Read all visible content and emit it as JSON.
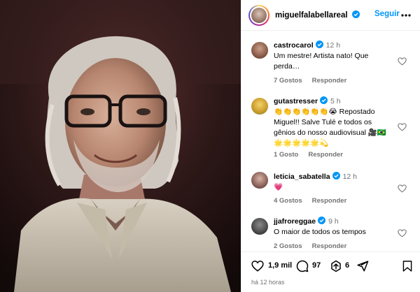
{
  "post": {
    "username": "miguelfalabellareal",
    "follow_label": "Seguir",
    "time_ago": "há 12 horas"
  },
  "comments": [
    {
      "username": "castrocarol",
      "time": "12 h",
      "text": "Um mestre! Artista nato! Que perda…",
      "likes": "7 Gostos",
      "reply": "Responder",
      "avatar_color": "#8a6a5a"
    },
    {
      "username": "gutastresser",
      "time": "5 h",
      "text": "👏👏👏👏👏👏😭 Repostado Miguel!! Salve Tulé e todos os gênios do nosso audiovisual 🎥🇧🇷 🌟🌟🌟🌟🌟💫",
      "likes": "1 Gosto",
      "reply": "Responder",
      "avatar_color": "#d9b84a"
    },
    {
      "username": "leticia_sabatella",
      "time": "12 h",
      "text": "💗",
      "likes": "4 Gostos",
      "reply": "Responder",
      "avatar_color": "#6a4a4a"
    },
    {
      "username": "jjafroreggae",
      "time": "9 h",
      "text": "O maior de todos os tempos",
      "likes": "2 Gostos",
      "reply": "Responder",
      "avatar_color": "#4a4a4a"
    }
  ],
  "actions": {
    "likes_count": "1,9 mil",
    "comments_count": "97",
    "shares_count": "6"
  },
  "colors": {
    "accent": "#0095f6",
    "verified": "#0095f6",
    "muted": "#737373"
  },
  "icons": [
    "verified-icon",
    "more-icon",
    "heart-icon",
    "comment-icon",
    "share-icon",
    "save-icon"
  ]
}
